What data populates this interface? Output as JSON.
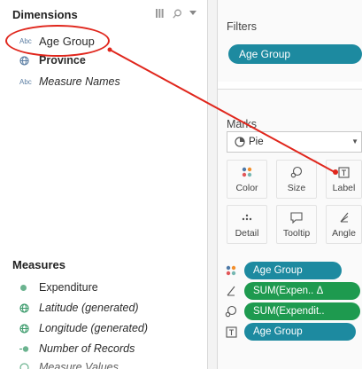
{
  "data_pane": {
    "dimensions_title": "Dimensions",
    "dimensions": [
      {
        "type_icon": "Abc",
        "name": "Age Group"
      },
      {
        "type_icon": "globe-icon",
        "name": "Province"
      },
      {
        "type_icon": "Abc",
        "name": "Measure Names"
      }
    ],
    "measures_title": "Measures",
    "measures": [
      {
        "type_icon": "measure-icon",
        "name": "Expenditure"
      },
      {
        "type_icon": "globe-icon",
        "name": "Latitude (generated)"
      },
      {
        "type_icon": "globe-icon",
        "name": "Longitude (generated)"
      },
      {
        "type_icon": "measure-icon",
        "name": "Number of Records"
      },
      {
        "type_icon": "globe-icon",
        "name": "Measure Values"
      }
    ]
  },
  "filters": {
    "title": "Filters",
    "pill": "Age Group"
  },
  "marks": {
    "title": "Marks",
    "mark_type": "Pie",
    "buttons": {
      "color": "Color",
      "size": "Size",
      "label": "Label",
      "detail": "Detail",
      "tooltip": "Tooltip",
      "angle": "Angle"
    },
    "encodings": [
      {
        "icon": "color-icon",
        "pill": "Age Group",
        "color": "#1d8aa0"
      },
      {
        "icon": "angle-icon",
        "pill": "SUM(Expen..  Δ",
        "color": "#1e9a4f"
      },
      {
        "icon": "size-icon",
        "pill": "SUM(Expendit..",
        "color": "#1e9a4f"
      },
      {
        "icon": "label-icon",
        "pill": "Age Group",
        "color": "#1d8aa0"
      }
    ]
  },
  "colors": {
    "discrete_pill": "#1d8aa0",
    "continuous_pill": "#1e9a4f",
    "highlight_ring": "#e0261c"
  }
}
